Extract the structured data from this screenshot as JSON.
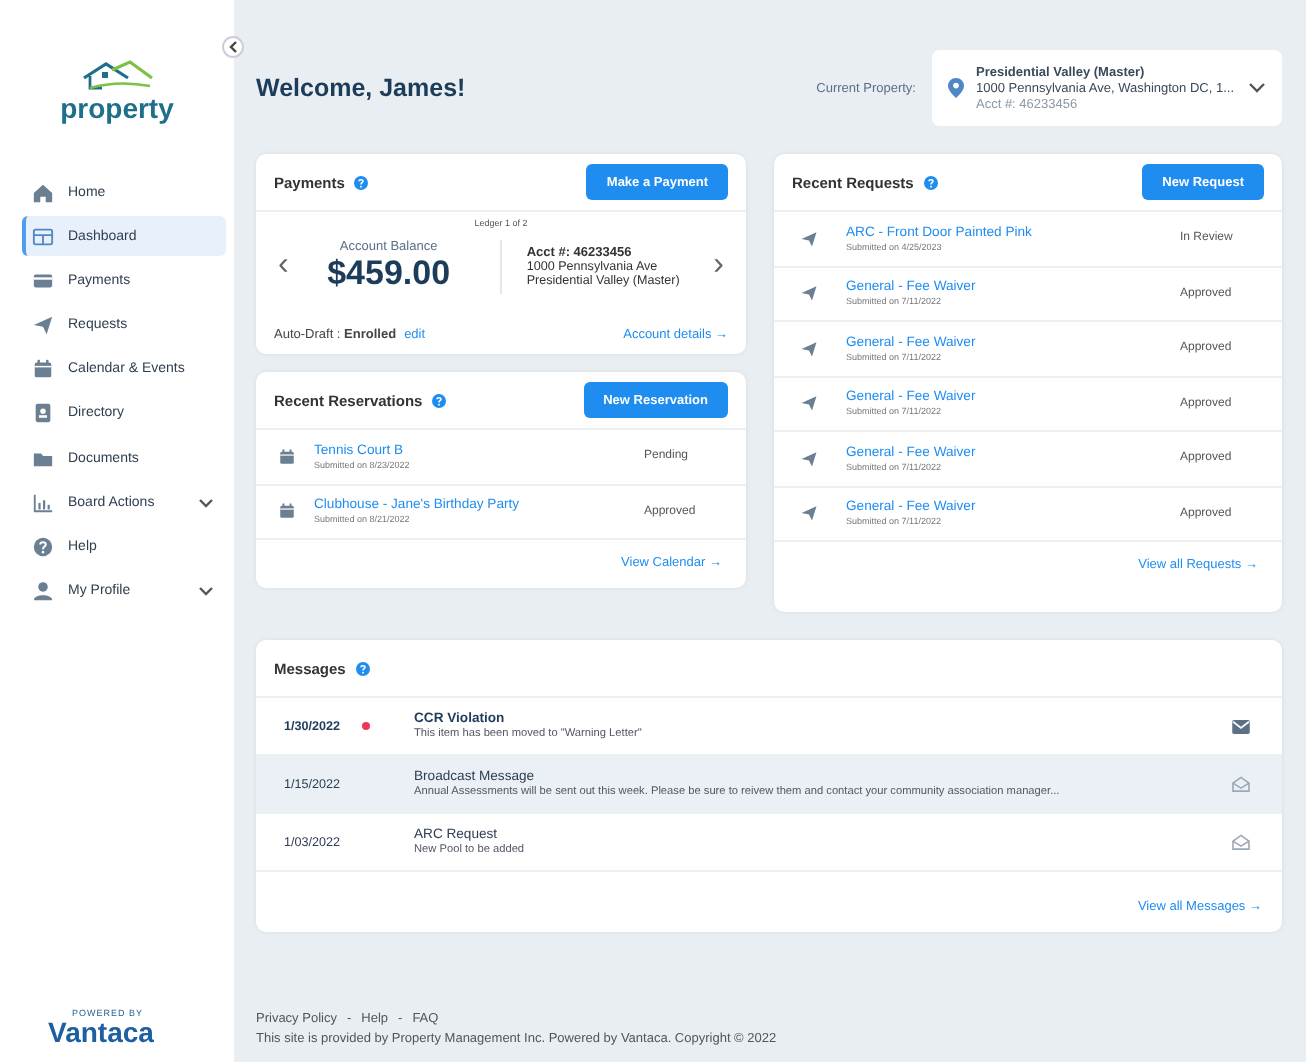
{
  "sidebar": {
    "logo": "property",
    "items": [
      {
        "label": "Home",
        "kind": "link",
        "selected": false
      },
      {
        "label": "Dashboard",
        "kind": "link",
        "selected": true
      },
      {
        "label": "Payments",
        "kind": "link",
        "selected": false
      },
      {
        "label": "Requests",
        "kind": "link",
        "selected": false
      },
      {
        "label": "Calendar & Events",
        "kind": "link",
        "selected": false
      },
      {
        "label": "Directory",
        "kind": "link",
        "selected": false
      },
      {
        "label": "Documents",
        "kind": "link",
        "selected": false
      },
      {
        "label": "Board Actions",
        "kind": "group",
        "selected": false
      },
      {
        "label": "Help",
        "kind": "link",
        "selected": false
      },
      {
        "label": "My Profile",
        "kind": "group",
        "selected": false
      }
    ],
    "powered_by": "POWERED BY",
    "brand": "Vantaca"
  },
  "header": {
    "welcome": "Welcome, James!",
    "property_label": "Current Property:",
    "property": {
      "name": "Presidential Valley (Master)",
      "address": "1000 Pennsylvania Ave, Washington DC, 1...",
      "account": "Acct #: 46233456"
    }
  },
  "payments": {
    "title": "Payments",
    "button": "Make a Payment",
    "ledger": "Ledger 1 of 2",
    "prev": "‹",
    "next": "›",
    "balance_label": "Account Balance",
    "balance": "$459.00",
    "account": "Acct #: 46233456",
    "address": "1000 Pennsylvania Ave",
    "property": "Presidential Valley (Master)",
    "autodraft": "Auto-Draft : **Enrolled**",
    "edit": "edit",
    "details_link": "Account details →"
  },
  "reservations": {
    "title": "Recent Reservations",
    "button": "New Reservation",
    "rows": [
      {
        "title": "Tennis Court B",
        "submitted": "Submitted on 8/23/2022",
        "status": "Pending"
      },
      {
        "title": "Clubhouse - Jane's Birthday Party",
        "submitted": "Submitted on 8/21/2022",
        "status": "Approved"
      }
    ],
    "link": "View Calendar →"
  },
  "requests": {
    "title": "Recent Requests",
    "button": "New Request",
    "rows": [
      {
        "title": "ARC - Front Door Painted Pink",
        "submitted": "Submitted on 4/25/2023",
        "status": "In Review"
      },
      {
        "title": "General - Fee Waiver",
        "submitted": "Submitted on 7/11/2022",
        "status": "Approved"
      },
      {
        "title": "General - Fee Waiver",
        "submitted": "Submitted on 7/11/2022",
        "status": "Approved"
      },
      {
        "title": "General - Fee Waiver",
        "submitted": "Submitted on 7/11/2022",
        "status": "Approved"
      },
      {
        "title": "General - Fee Waiver",
        "submitted": "Submitted on 7/11/2022",
        "status": "Approved"
      },
      {
        "title": "General - Fee Waiver",
        "submitted": "Submitted on 7/11/2022",
        "status": "Approved"
      }
    ],
    "link": "View all Requests →"
  },
  "messages": {
    "title": "Messages",
    "rows": [
      {
        "date": "1/30/2022",
        "title": "CCR Violation",
        "body": "This item has been moved to \"Warning Letter\"",
        "unread": true,
        "selected": false
      },
      {
        "date": "1/15/2022",
        "title": "Broadcast Message",
        "body": "Annual Assessments will be sent out this week. Please be sure to reivew them and contact your community association manager...",
        "unread": false,
        "selected": true
      },
      {
        "date": "1/03/2022",
        "title": "ARC Request",
        "body": "New Pool to be added",
        "unread": false,
        "selected": false
      }
    ],
    "link": "View all Messages →"
  },
  "footer": {
    "links": [
      "Privacy Policy",
      "-",
      "Help",
      "-",
      "FAQ"
    ],
    "copyright": "This site is provided by Property Management Inc. Powered by Vantaca. Copyright © 2022"
  }
}
